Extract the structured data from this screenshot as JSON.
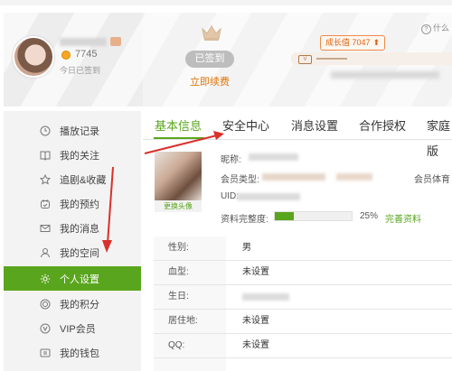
{
  "header": {
    "points": "7745",
    "signed_today": "今日已签到",
    "signed_button": "已签到",
    "renew_link": "立即续费",
    "growth_badge": "成长值  7047",
    "help_text": "什么"
  },
  "sidebar": {
    "items": [
      {
        "label": "播放记录",
        "icon": "clock-icon"
      },
      {
        "label": "我的关注",
        "icon": "book-icon"
      },
      {
        "label": "追剧&收藏",
        "icon": "star-icon"
      },
      {
        "label": "我的预约",
        "icon": "calendar-icon"
      },
      {
        "label": "我的消息",
        "icon": "mail-icon"
      },
      {
        "label": "我的空间",
        "icon": "person-icon"
      },
      {
        "label": "个人设置",
        "icon": "gear-icon",
        "active": true
      },
      {
        "label": "我的积分",
        "icon": "coin-icon"
      },
      {
        "label": "VIP会员",
        "icon": "vip-icon"
      },
      {
        "label": "我的钱包",
        "icon": "wallet-icon"
      }
    ]
  },
  "tabs": [
    "基本信息",
    "安全中心",
    "消息设置",
    "合作授权",
    "家庭版"
  ],
  "profile": {
    "change_avatar": "更换头像",
    "nickname_label": "昵称:",
    "member_type_label": "会员类型:",
    "uid_label": "UID:",
    "completeness_label": "资料完整度:",
    "completeness_value": 25,
    "completeness_text": "25%",
    "complete_link": "完善资料",
    "right_cut_label": "会员体育"
  },
  "info_rows": [
    {
      "key": "性别:",
      "value": "男"
    },
    {
      "key": "血型:",
      "value": "未设置"
    },
    {
      "key": "生日:",
      "value": ""
    },
    {
      "key": "居住地:",
      "value": "未设置"
    },
    {
      "key": "QQ:",
      "value": "未设置"
    }
  ],
  "colors": {
    "accent_green": "#5aa51e",
    "orange": "#e0760b",
    "annotation_red": "#d9312b"
  }
}
